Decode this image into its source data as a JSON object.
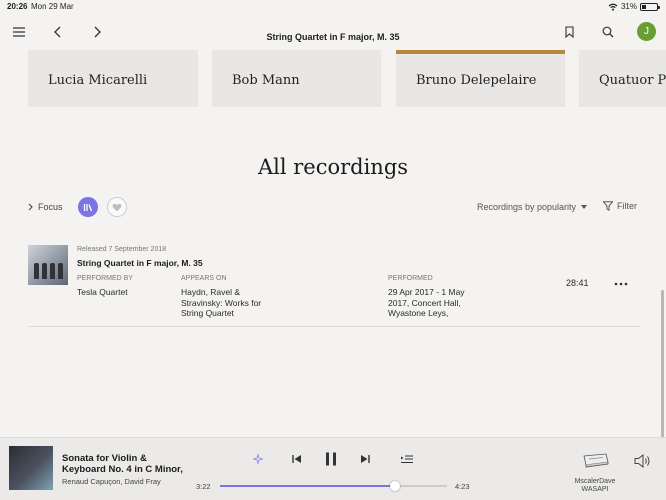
{
  "status_bar": {
    "time": "20:26",
    "date": "Mon 29 Mar",
    "battery": "31%"
  },
  "header": {
    "title": "String Quartet in F major, M. 35",
    "avatar_initial": "J"
  },
  "performers": [
    {
      "name": "Lucia Micarelli",
      "strip": "#e8e7e5"
    },
    {
      "name": "Bob Mann",
      "strip": "#e8e7e5"
    },
    {
      "name": "Bruno Delepelaire",
      "strip": "#b8863c"
    },
    {
      "name": "Quatuor Psophos",
      "strip": "#e8e7e5"
    }
  ],
  "section": {
    "title": "All recordings"
  },
  "controls": {
    "focus": "Focus",
    "sort": "Recordings by popularity",
    "filter": "Filter"
  },
  "recording": {
    "released": "Released 7 September 2018",
    "title": "String Quartet in F major, M. 35",
    "performed_by_label": "PERFORMED BY",
    "performed_by": "Tesla Quartet",
    "appears_on_label": "APPEARS ON",
    "appears_on": [
      "Haydn, Ravel &",
      "Stravinsky: Works for",
      "String Quartet"
    ],
    "performed_label": "PERFORMED",
    "performed": [
      "29 Apr 2017 - 1 May",
      "2017, Concert Hall,",
      "Wyastone Leys,"
    ],
    "duration": "28:41"
  },
  "player": {
    "title_lines": [
      "Sonata for Violin &",
      "Keyboard No. 4 in C Minor,"
    ],
    "artist": "Renaud Capuçon, David Fray",
    "current_time": "3:22",
    "total_time": "4:23",
    "progress_fraction": 0.77,
    "device_name": "MscalerDave",
    "device_output": "WASAPI"
  },
  "colors": {
    "accent": "#7a74e4",
    "avatar": "#6a9e34"
  }
}
